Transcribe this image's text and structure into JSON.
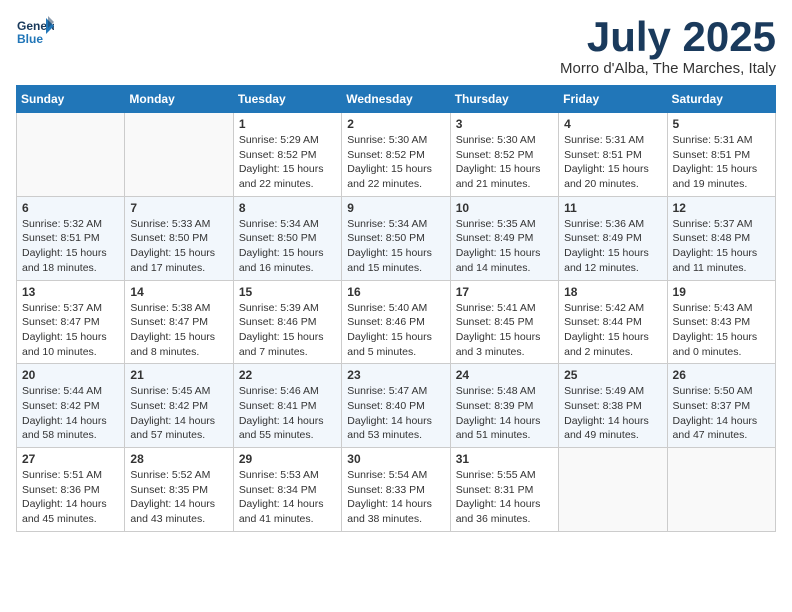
{
  "header": {
    "logo_line1": "General",
    "logo_line2": "Blue",
    "month": "July 2025",
    "location": "Morro d'Alba, The Marches, Italy"
  },
  "weekdays": [
    "Sunday",
    "Monday",
    "Tuesday",
    "Wednesday",
    "Thursday",
    "Friday",
    "Saturday"
  ],
  "weeks": [
    [
      {
        "day": "",
        "info": ""
      },
      {
        "day": "",
        "info": ""
      },
      {
        "day": "1",
        "info": "Sunrise: 5:29 AM\nSunset: 8:52 PM\nDaylight: 15 hours\nand 22 minutes."
      },
      {
        "day": "2",
        "info": "Sunrise: 5:30 AM\nSunset: 8:52 PM\nDaylight: 15 hours\nand 22 minutes."
      },
      {
        "day": "3",
        "info": "Sunrise: 5:30 AM\nSunset: 8:52 PM\nDaylight: 15 hours\nand 21 minutes."
      },
      {
        "day": "4",
        "info": "Sunrise: 5:31 AM\nSunset: 8:51 PM\nDaylight: 15 hours\nand 20 minutes."
      },
      {
        "day": "5",
        "info": "Sunrise: 5:31 AM\nSunset: 8:51 PM\nDaylight: 15 hours\nand 19 minutes."
      }
    ],
    [
      {
        "day": "6",
        "info": "Sunrise: 5:32 AM\nSunset: 8:51 PM\nDaylight: 15 hours\nand 18 minutes."
      },
      {
        "day": "7",
        "info": "Sunrise: 5:33 AM\nSunset: 8:50 PM\nDaylight: 15 hours\nand 17 minutes."
      },
      {
        "day": "8",
        "info": "Sunrise: 5:34 AM\nSunset: 8:50 PM\nDaylight: 15 hours\nand 16 minutes."
      },
      {
        "day": "9",
        "info": "Sunrise: 5:34 AM\nSunset: 8:50 PM\nDaylight: 15 hours\nand 15 minutes."
      },
      {
        "day": "10",
        "info": "Sunrise: 5:35 AM\nSunset: 8:49 PM\nDaylight: 15 hours\nand 14 minutes."
      },
      {
        "day": "11",
        "info": "Sunrise: 5:36 AM\nSunset: 8:49 PM\nDaylight: 15 hours\nand 12 minutes."
      },
      {
        "day": "12",
        "info": "Sunrise: 5:37 AM\nSunset: 8:48 PM\nDaylight: 15 hours\nand 11 minutes."
      }
    ],
    [
      {
        "day": "13",
        "info": "Sunrise: 5:37 AM\nSunset: 8:47 PM\nDaylight: 15 hours\nand 10 minutes."
      },
      {
        "day": "14",
        "info": "Sunrise: 5:38 AM\nSunset: 8:47 PM\nDaylight: 15 hours\nand 8 minutes."
      },
      {
        "day": "15",
        "info": "Sunrise: 5:39 AM\nSunset: 8:46 PM\nDaylight: 15 hours\nand 7 minutes."
      },
      {
        "day": "16",
        "info": "Sunrise: 5:40 AM\nSunset: 8:46 PM\nDaylight: 15 hours\nand 5 minutes."
      },
      {
        "day": "17",
        "info": "Sunrise: 5:41 AM\nSunset: 8:45 PM\nDaylight: 15 hours\nand 3 minutes."
      },
      {
        "day": "18",
        "info": "Sunrise: 5:42 AM\nSunset: 8:44 PM\nDaylight: 15 hours\nand 2 minutes."
      },
      {
        "day": "19",
        "info": "Sunrise: 5:43 AM\nSunset: 8:43 PM\nDaylight: 15 hours\nand 0 minutes."
      }
    ],
    [
      {
        "day": "20",
        "info": "Sunrise: 5:44 AM\nSunset: 8:42 PM\nDaylight: 14 hours\nand 58 minutes."
      },
      {
        "day": "21",
        "info": "Sunrise: 5:45 AM\nSunset: 8:42 PM\nDaylight: 14 hours\nand 57 minutes."
      },
      {
        "day": "22",
        "info": "Sunrise: 5:46 AM\nSunset: 8:41 PM\nDaylight: 14 hours\nand 55 minutes."
      },
      {
        "day": "23",
        "info": "Sunrise: 5:47 AM\nSunset: 8:40 PM\nDaylight: 14 hours\nand 53 minutes."
      },
      {
        "day": "24",
        "info": "Sunrise: 5:48 AM\nSunset: 8:39 PM\nDaylight: 14 hours\nand 51 minutes."
      },
      {
        "day": "25",
        "info": "Sunrise: 5:49 AM\nSunset: 8:38 PM\nDaylight: 14 hours\nand 49 minutes."
      },
      {
        "day": "26",
        "info": "Sunrise: 5:50 AM\nSunset: 8:37 PM\nDaylight: 14 hours\nand 47 minutes."
      }
    ],
    [
      {
        "day": "27",
        "info": "Sunrise: 5:51 AM\nSunset: 8:36 PM\nDaylight: 14 hours\nand 45 minutes."
      },
      {
        "day": "28",
        "info": "Sunrise: 5:52 AM\nSunset: 8:35 PM\nDaylight: 14 hours\nand 43 minutes."
      },
      {
        "day": "29",
        "info": "Sunrise: 5:53 AM\nSunset: 8:34 PM\nDaylight: 14 hours\nand 41 minutes."
      },
      {
        "day": "30",
        "info": "Sunrise: 5:54 AM\nSunset: 8:33 PM\nDaylight: 14 hours\nand 38 minutes."
      },
      {
        "day": "31",
        "info": "Sunrise: 5:55 AM\nSunset: 8:31 PM\nDaylight: 14 hours\nand 36 minutes."
      },
      {
        "day": "",
        "info": ""
      },
      {
        "day": "",
        "info": ""
      }
    ]
  ]
}
